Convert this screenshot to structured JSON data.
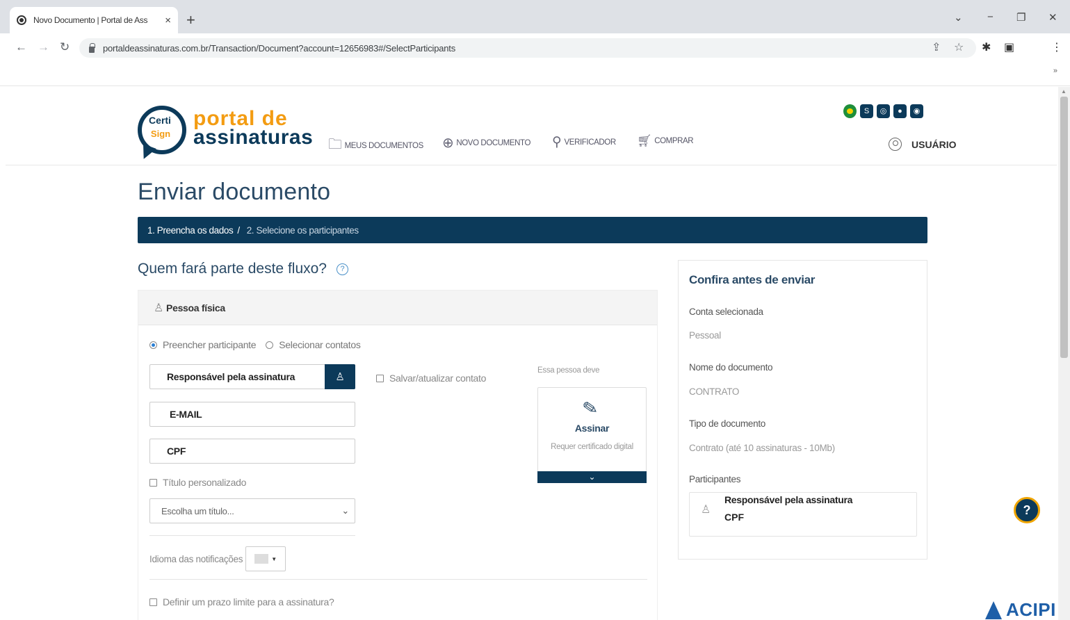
{
  "browser": {
    "tab_title": "Novo Documento | Portal de Ass",
    "tab_close": "×",
    "new_tab": "+",
    "url": "portaldeassinaturas.com.br/Transaction/Document?account=12656983#/SelectParticipants",
    "window_controls": [
      "⌄",
      "−",
      "❐",
      "✕"
    ]
  },
  "header": {
    "logo": {
      "certi": "Certi",
      "sign": "Sign",
      "line1": "portal de",
      "line2": "assinaturas"
    },
    "menu": [
      {
        "label": "MEUS DOCUMENTOS",
        "icon": "folder-icon"
      },
      {
        "label": "NOVO DOCUMENTO",
        "icon": "plus-circle-icon"
      },
      {
        "label": "VERIFICADOR",
        "icon": "search-icon"
      },
      {
        "label": "COMPRAR",
        "icon": "cart-icon"
      }
    ],
    "user": "USUÁRIO"
  },
  "page": {
    "title": "Enviar documento",
    "steps": {
      "step1": "1. Preencha os dados",
      "sep": "/",
      "step2": "2. Selecione os participantes"
    },
    "question": "Quem fará parte deste fluxo?",
    "card": {
      "type": "Pessoa física",
      "radio1": "Preencher participante",
      "radio2": "Selecionar contatos",
      "name_value": "Responsável pela assinatura",
      "email_value": "E-MAIL",
      "cpf_value": "CPF",
      "save_contact": "Salvar/atualizar contato",
      "custom_title": "Título personalizado",
      "title_select": "Escolha um título...",
      "language_label": "Idioma das notificações",
      "deadline": "Definir um prazo limite para a assinatura?",
      "must_label": "Essa pessoa deve",
      "sign_title": "Assinar",
      "sign_desc": "Requer certificado digital"
    },
    "side": {
      "title": "Confira antes de enviar",
      "account_label": "Conta selecionada",
      "account_value": "Pessoal",
      "docname_label": "Nome do documento",
      "docname_value": "CONTRATO",
      "doctype_label": "Tipo de documento",
      "doctype_value": "Contrato (até 10 assinaturas - 10Mb)",
      "participants_label": "Participantes",
      "participant_name": "Responsável pela assinatura",
      "participant_doc": "CPF"
    }
  },
  "watermark": "ACIPI",
  "colors": {
    "navy": "#0c3a5a",
    "orange": "#f39c12",
    "title": "#2a4a66"
  }
}
